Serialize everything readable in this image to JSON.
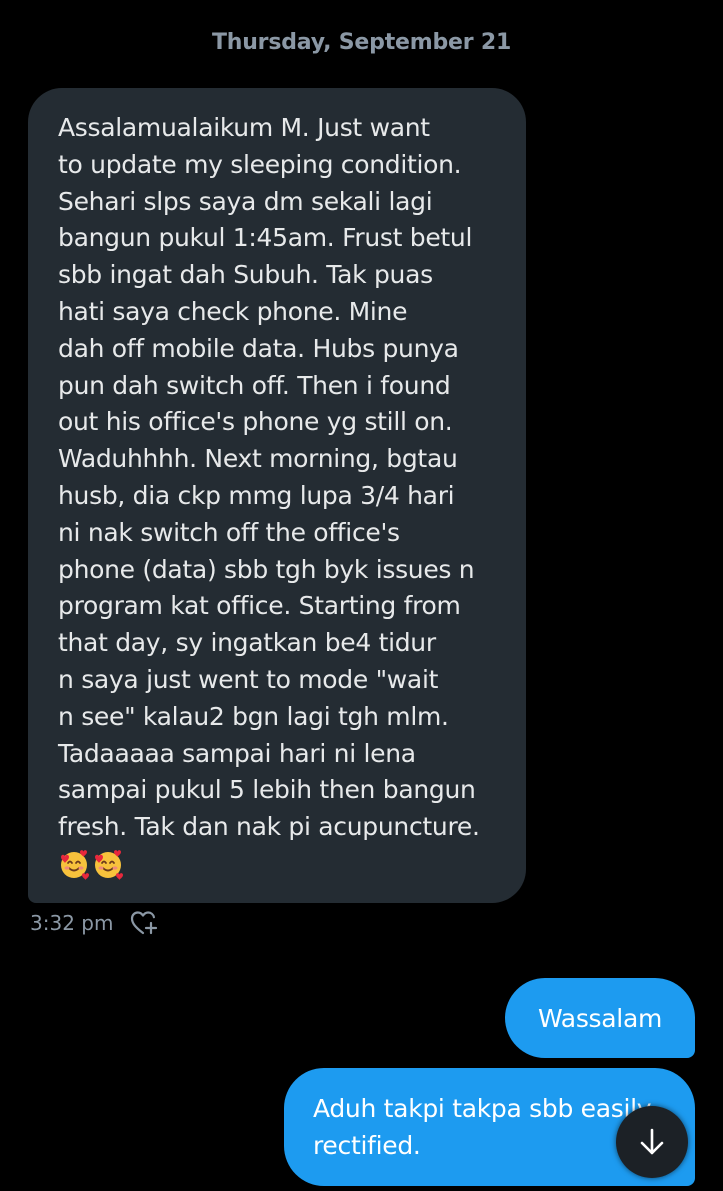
{
  "conversation": {
    "date_separator": "Thursday, September 21"
  },
  "incoming_message": {
    "lines": [
      "Assalamualaikum M. Just want",
      "to update my sleeping condition.",
      "Sehari slps saya dm sekali lagi",
      "bangun pukul 1:45am. Frust betul",
      "sbb ingat dah Subuh. Tak puas",
      "hati saya check phone. Mine",
      "dah off mobile data. Hubs punya",
      "pun dah switch off. Then i found",
      "out his office's phone yg still on.",
      "Waduhhhh. Next morning, bgtau",
      "husb, dia ckp mmg lupa 3/4 hari",
      "ni nak switch off the office's",
      "phone (data) sbb tgh byk issues n",
      "program kat office. Starting from",
      "that day, sy ingatkan be4 tidur",
      "n saya just went to mode \"wait",
      "n see\" kalau2 bgn lagi tgh mlm.",
      "Tadaaaaa sampai hari ni lena",
      "sampai pukul 5 lebih then bangun",
      "fresh. Tak dan nak pi acupuncture."
    ],
    "emojis": [
      "smiling-face-with-hearts-icon",
      "smiling-face-with-hearts-icon"
    ],
    "timestamp": "3:32 pm",
    "react_icon": "add-reaction-heart-icon"
  },
  "outgoing_messages": [
    {
      "lines": [
        "Wassalam"
      ]
    },
    {
      "lines": [
        "Aduh takpi takpa sbb easily",
        "rectified."
      ]
    }
  ],
  "scroll_button": {
    "icon": "arrow-down-icon"
  },
  "colors": {
    "background": "#000000",
    "incoming_bubble": "#242c33",
    "outgoing_bubble": "#1d9bf0",
    "secondary_text": "#8b98a5",
    "primary_text": "#e7e9ea"
  }
}
